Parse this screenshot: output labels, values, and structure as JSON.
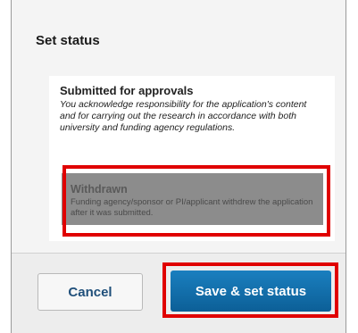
{
  "dialog": {
    "title": "Set status"
  },
  "options": [
    {
      "title": "Submitted for approvals",
      "description": "You acknowledge responsibility for the application's content and for carrying out the research in accordance with both university and funding agency regulations."
    },
    {
      "title": "Withdrawn",
      "description": "Funding agency/sponsor or PI/applicant withdrew the application after it was submitted."
    }
  ],
  "footer": {
    "cancel_label": "Cancel",
    "save_label": "Save & set status"
  },
  "colors": {
    "highlight": "#e00000",
    "primary_button": "#0c5f97",
    "selected_option_bg": "#8c8c8c"
  }
}
